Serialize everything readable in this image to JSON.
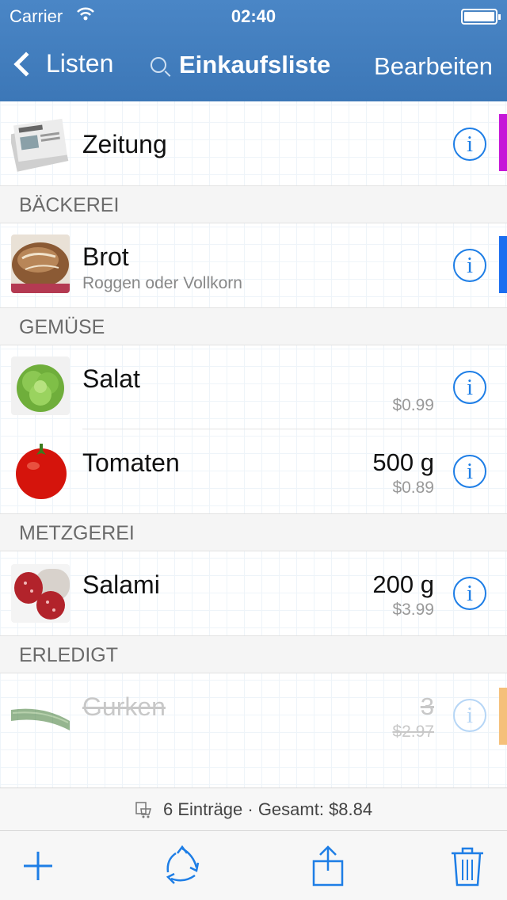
{
  "status": {
    "carrier": "Carrier",
    "time": "02:40"
  },
  "nav": {
    "back_label": "Listen",
    "title": "Einkaufsliste",
    "edit_label": "Bearbeiten"
  },
  "items_top": [
    {
      "name": "Zeitung",
      "color": "#c616d8",
      "image": "newspaper"
    }
  ],
  "sections": [
    {
      "title": "BÄCKEREI",
      "items": [
        {
          "name": "Brot",
          "note": "Roggen oder Vollkorn",
          "color": "#1b6ef0",
          "image": "bread"
        }
      ]
    },
    {
      "title": "GEMÜSE",
      "items": [
        {
          "name": "Salat",
          "price": "$0.99",
          "image": "lettuce"
        },
        {
          "name": "Tomaten",
          "quantity": "500 g",
          "price": "$0.89",
          "image": "tomato"
        }
      ]
    },
    {
      "title": "METZGEREI",
      "items": [
        {
          "name": "Salami",
          "quantity": "200 g",
          "price": "$3.99",
          "image": "salami"
        }
      ]
    },
    {
      "title": "ERLEDIGT",
      "items": [
        {
          "name": "Gurken",
          "quantity": "3",
          "price": "$2.97",
          "color": "#f5c07a",
          "image": "cucumber",
          "done": true
        }
      ]
    }
  ],
  "info_glyph": "i",
  "summary": {
    "text": "6 Einträge · Gesamt: $8.84"
  },
  "toolbar": {
    "icons": [
      "plus-icon",
      "recycle-icon",
      "share-icon",
      "trash-icon"
    ]
  },
  "colors": {
    "nav_bar": "#3c77b7",
    "tint": "#1e7ee6"
  }
}
